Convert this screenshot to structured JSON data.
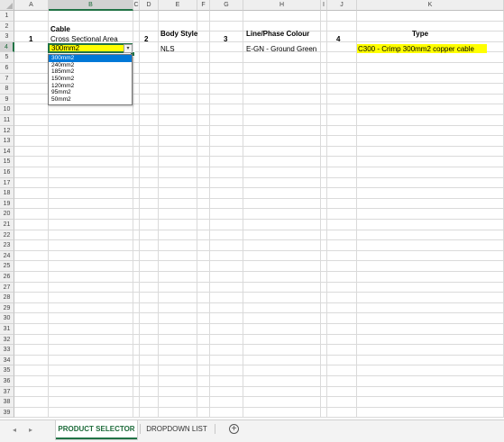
{
  "columns": [
    "A",
    "B",
    "C",
    "D",
    "E",
    "F",
    "G",
    "H",
    "I",
    "J",
    "K"
  ],
  "rows": [
    "1",
    "2",
    "3",
    "4",
    "5",
    "6",
    "7",
    "8",
    "9",
    "10",
    "11",
    "12",
    "13",
    "14",
    "15",
    "16",
    "17",
    "18",
    "19",
    "20",
    "21",
    "22",
    "23",
    "24",
    "25",
    "26",
    "27",
    "28",
    "29",
    "30",
    "31",
    "32",
    "33",
    "34",
    "35",
    "36",
    "37",
    "38",
    "39"
  ],
  "cells": {
    "a3": "1",
    "b2": "Cable",
    "b3": "Cross Sectional Area",
    "b4": "300mm2",
    "d3": "2",
    "e2": "Body Style",
    "e4": "NLS",
    "g3": "3",
    "h2": "Line/Phase Colour",
    "h4": "E-GN - Ground Green",
    "j3": "4",
    "k2": "Type",
    "k4": "C300 - Crimp 300mm2 copper cable"
  },
  "dropdown": {
    "arrow": "▾",
    "options": [
      "300mm2",
      "240mm2",
      "185mm2",
      "150mm2",
      "120mm2",
      "95mm2",
      "50mm2"
    ],
    "selected_index": 0
  },
  "tabs": [
    {
      "label": "PRODUCT SELECTOR",
      "active": true
    },
    {
      "label": "DROPDOWN LIST",
      "active": false
    }
  ],
  "nav": {
    "prev": "◂",
    "next": "▸",
    "add": "+"
  },
  "colors": {
    "accent": "#217346",
    "highlight": "#ffff00",
    "selection": "#0078d7"
  }
}
